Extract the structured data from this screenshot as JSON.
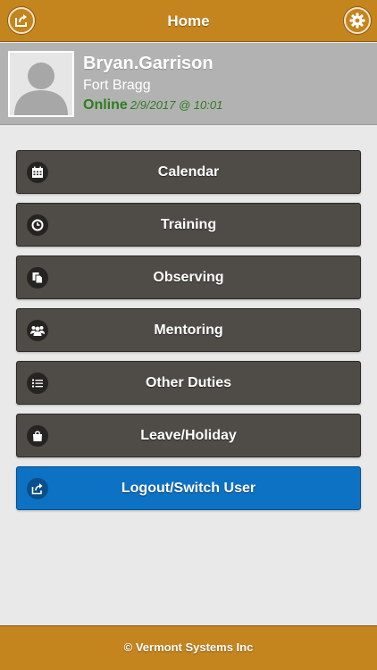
{
  "header": {
    "title": "Home",
    "left_icon": "share-icon",
    "right_icon": "gear-icon"
  },
  "profile": {
    "username": "Bryan.Garrison",
    "location": "Fort Bragg",
    "status": "Online",
    "status_time": "2/9/2017 @ 10:01"
  },
  "menu": {
    "items": [
      {
        "label": "Calendar",
        "icon": "calendar-icon"
      },
      {
        "label": "Training",
        "icon": "clock-icon"
      },
      {
        "label": "Observing",
        "icon": "documents-icon"
      },
      {
        "label": "Mentoring",
        "icon": "users-icon"
      },
      {
        "label": "Other Duties",
        "icon": "list-icon"
      },
      {
        "label": "Leave/Holiday",
        "icon": "shopping-bag-icon"
      },
      {
        "label": "Logout/Switch User",
        "icon": "share-icon"
      }
    ]
  },
  "footer": {
    "copyright": "© Vermont Systems Inc"
  },
  "colors": {
    "brand": "#c4841e",
    "button": "#4f4c48",
    "logout": "#0e72c4",
    "online": "#2e7d1e"
  }
}
